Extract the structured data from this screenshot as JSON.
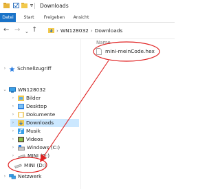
{
  "window": {
    "title": "Downloads"
  },
  "ribbon": {
    "tabs": [
      {
        "label": "Datei",
        "active": true
      },
      {
        "label": "Start"
      },
      {
        "label": "Freigeben"
      },
      {
        "label": "Ansicht"
      }
    ]
  },
  "navigation": {
    "back_icon": "back-arrow-icon",
    "forward_icon": "forward-arrow-icon",
    "up_icon": "up-arrow-icon",
    "recent_icon": "chevron-down-icon"
  },
  "address": {
    "path": [
      "WN128032",
      "Downloads"
    ]
  },
  "sidebar": {
    "items": [
      {
        "label": "Schnellzugriff",
        "icon": "star-icon",
        "expander": "›"
      },
      {
        "label": "WN128032",
        "icon": "computer-icon",
        "expander": "⌄"
      },
      {
        "label": "Bilder",
        "icon": "pictures-folder-icon",
        "expander": "›"
      },
      {
        "label": "Desktop",
        "icon": "desktop-folder-icon",
        "expander": "›"
      },
      {
        "label": "Dokumente",
        "icon": "documents-folder-icon",
        "expander": "›"
      },
      {
        "label": "Downloads",
        "icon": "downloads-folder-icon",
        "expander": "›",
        "selected": true
      },
      {
        "label": "Musik",
        "icon": "music-folder-icon",
        "expander": "›"
      },
      {
        "label": "Videos",
        "icon": "videos-folder-icon",
        "expander": "›"
      },
      {
        "label": "Windows (C:)",
        "icon": "drive-icon",
        "expander": "›"
      },
      {
        "label": "MINI (D:)",
        "icon": "usb-drive-icon",
        "expander": "›"
      },
      {
        "label": "MINI (D:)",
        "icon": "usb-drive-icon",
        "expander": ""
      },
      {
        "label": "Netzwerk",
        "icon": "network-icon",
        "expander": "›"
      }
    ]
  },
  "content": {
    "column_header": "Name",
    "files": [
      {
        "name": "mini-meinCode.hex",
        "icon": "file-icon"
      }
    ]
  },
  "annotation": {
    "color": "#e02020",
    "description_shapes": [
      "ellipse-around-file",
      "ellipse-around-drive",
      "arrow-file-to-drive"
    ]
  },
  "colors": {
    "accent": "#1a73c8",
    "selected": "#cce8ff",
    "annotation": "#e02020"
  }
}
